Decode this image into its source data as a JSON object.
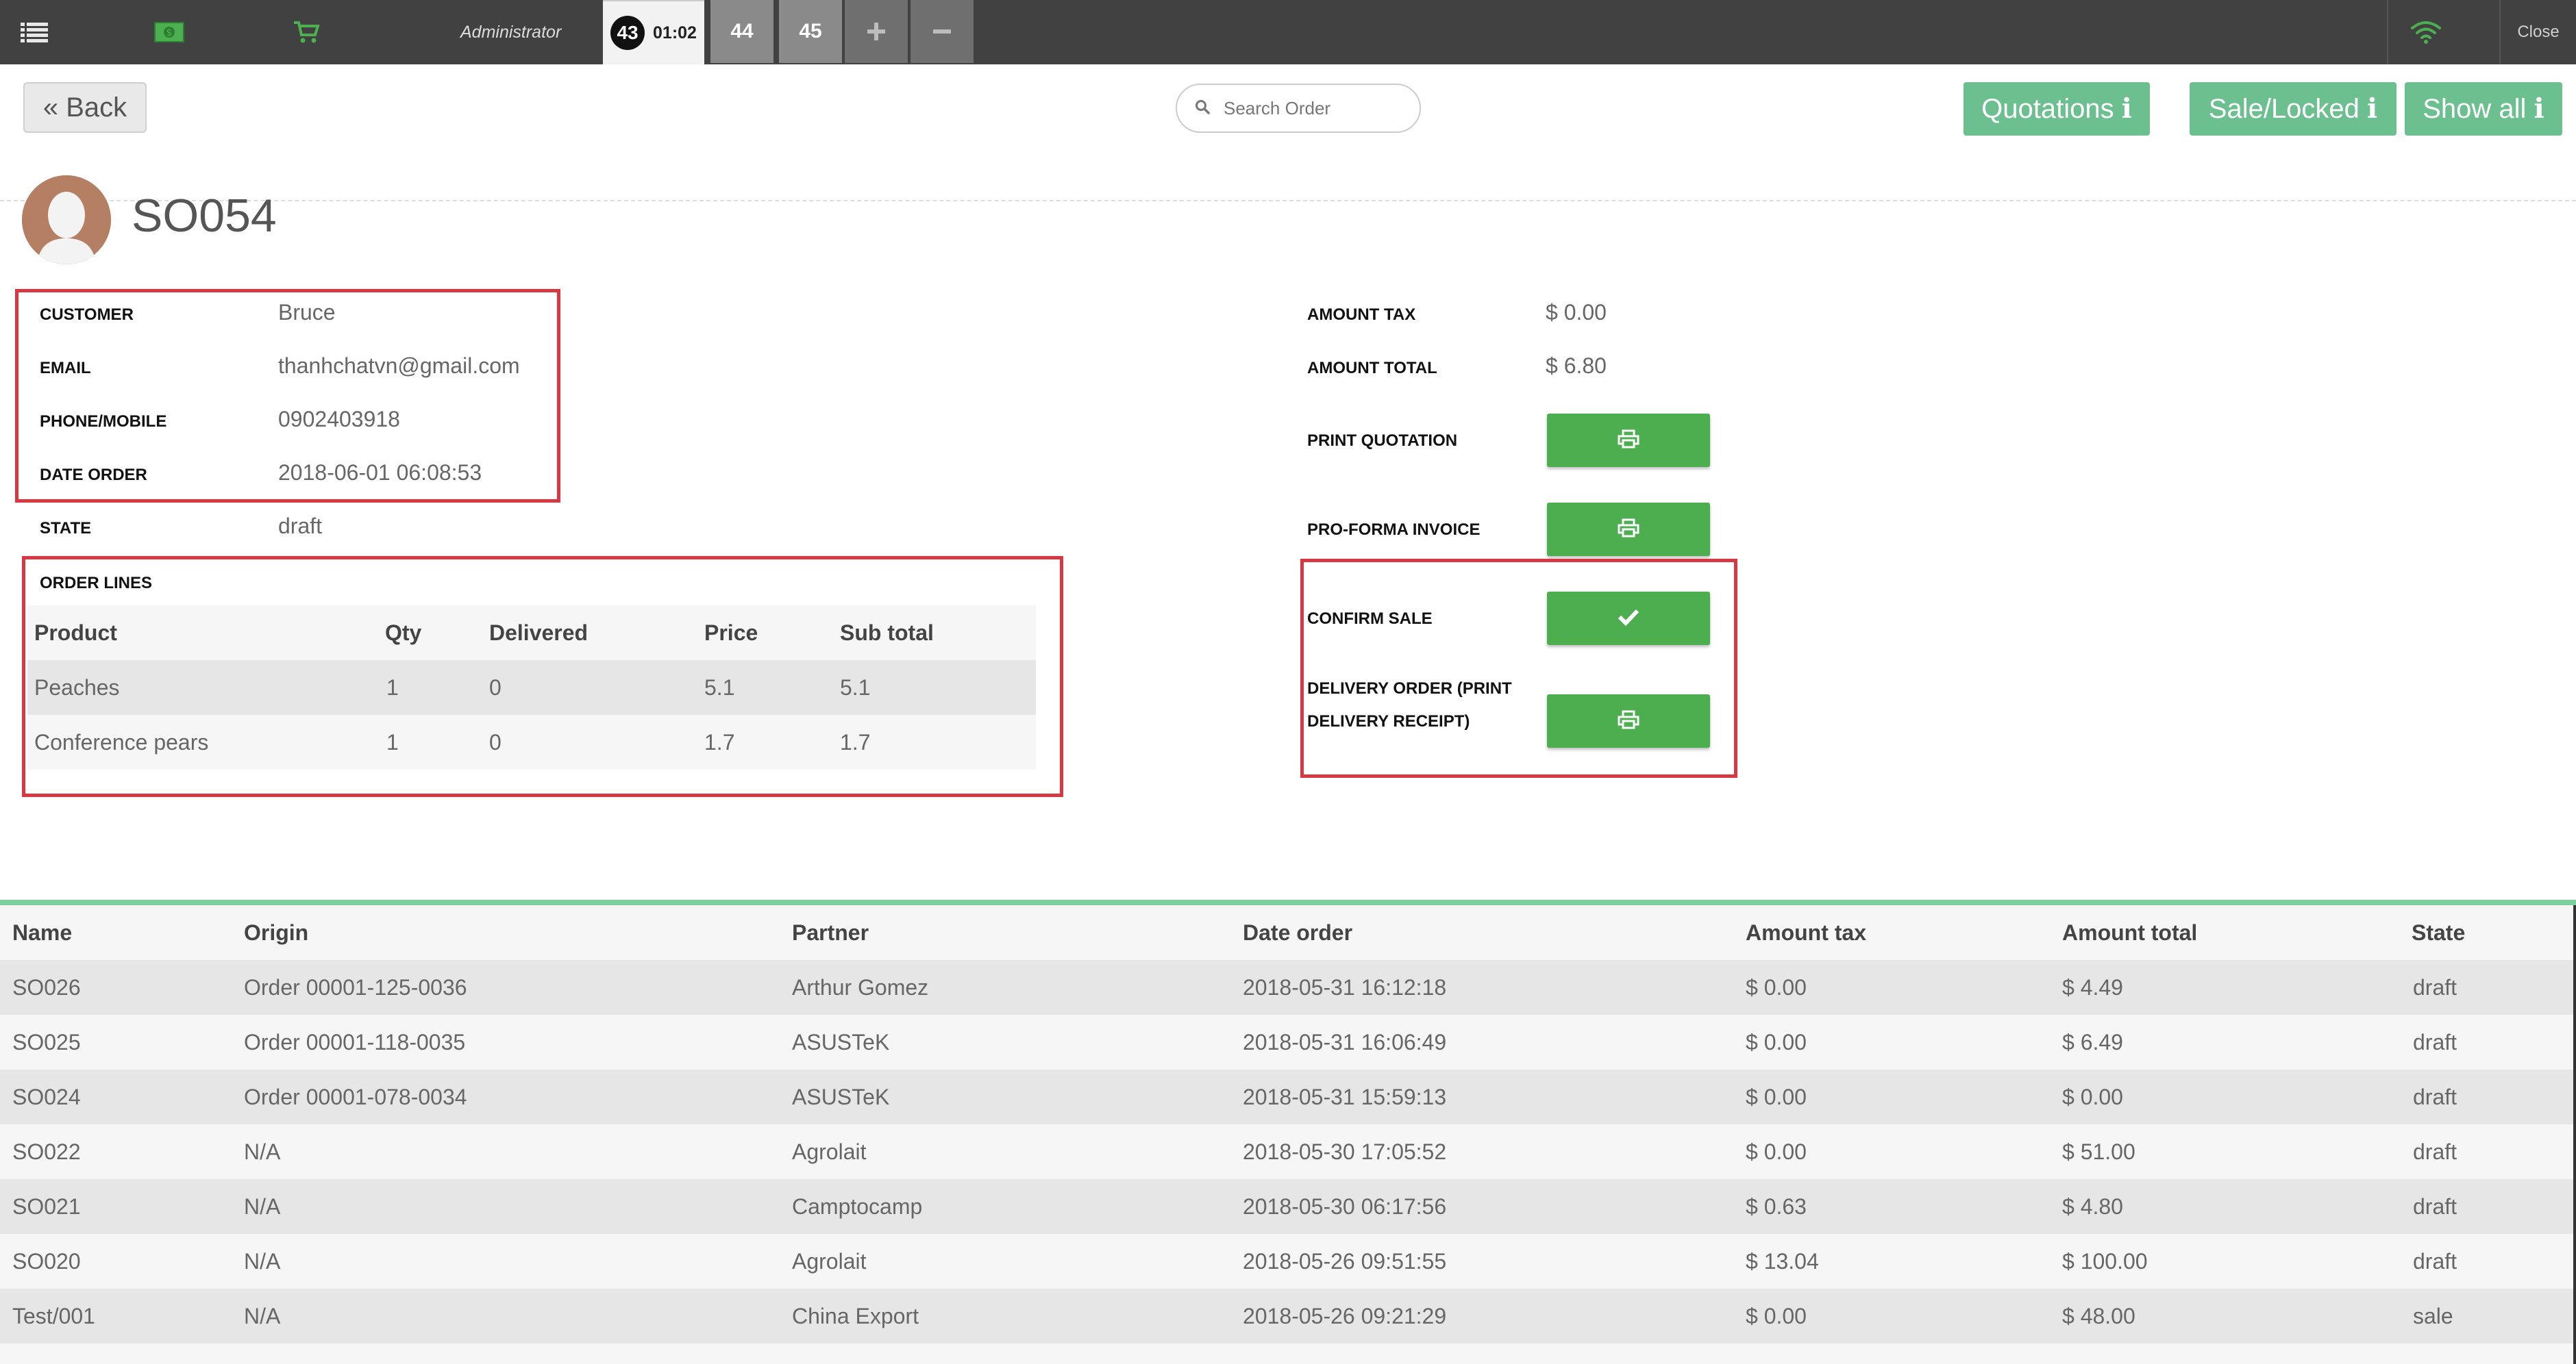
{
  "topbar": {
    "user": "Administrator",
    "orders": [
      {
        "number": "43",
        "time": "01:02",
        "active": true
      },
      {
        "number": "44",
        "active": false
      },
      {
        "number": "45",
        "active": false
      }
    ],
    "close_label": "Close"
  },
  "header": {
    "back_label": "« Back",
    "search_placeholder": "Search Order",
    "quotations_label": "Quotations ℹ",
    "sale_locked_label": "Sale/Locked ℹ",
    "show_all_label": "Show all ℹ"
  },
  "order": {
    "name": "SO054",
    "customer_label": "CUSTOMER",
    "customer": "Bruce",
    "email_label": "EMAIL",
    "email": "thanhchatvn@gmail.com",
    "phone_label": "PHONE/MOBILE",
    "phone": "0902403918",
    "date_label": "DATE ORDER",
    "date": "2018-06-01 06:08:53",
    "state_label": "STATE",
    "state": "draft",
    "amount_tax_label": "AMOUNT TAX",
    "amount_tax": "$ 0.00",
    "amount_total_label": "AMOUNT TOTAL",
    "amount_total": "$ 6.80",
    "print_quotation_label": "PRINT QUOTATION",
    "proforma_label": "PRO-FORMA INVOICE",
    "confirm_sale_label": "CONFIRM SALE",
    "delivery_label_1": "DELIVERY ORDER (PRINT",
    "delivery_label_2": "DELIVERY RECEIPT)"
  },
  "order_lines": {
    "title": "ORDER LINES",
    "headers": [
      "Product",
      "Qty",
      "Delivered",
      "Price",
      "Sub total"
    ],
    "rows": [
      [
        "Peaches",
        "1",
        "0",
        "5.1",
        "5.1"
      ],
      [
        "Conference pears",
        "1",
        "0",
        "1.7",
        "1.7"
      ]
    ]
  },
  "orders_table": {
    "headers": [
      "Name",
      "Origin",
      "Partner",
      "Date order",
      "Amount tax",
      "Amount total",
      "State"
    ],
    "rows": [
      [
        "SO026",
        "Order 00001-125-0036",
        "Arthur Gomez",
        "2018-05-31 16:12:18",
        "$ 0.00",
        "$ 4.49",
        "draft"
      ],
      [
        "SO025",
        "Order 00001-118-0035",
        "ASUSTeK",
        "2018-05-31 16:06:49",
        "$ 0.00",
        "$ 6.49",
        "draft"
      ],
      [
        "SO024",
        "Order 00001-078-0034",
        "ASUSTeK",
        "2018-05-31 15:59:13",
        "$ 0.00",
        "$ 0.00",
        "draft"
      ],
      [
        "SO022",
        "N/A",
        "Agrolait",
        "2018-05-30 17:05:52",
        "$ 0.00",
        "$ 51.00",
        "draft"
      ],
      [
        "SO021",
        "N/A",
        "Camptocamp",
        "2018-05-30 06:17:56",
        "$ 0.63",
        "$ 4.80",
        "draft"
      ],
      [
        "SO020",
        "N/A",
        "Agrolait",
        "2018-05-26 09:51:55",
        "$ 13.04",
        "$ 100.00",
        "draft"
      ],
      [
        "Test/001",
        "N/A",
        "China Export",
        "2018-05-26 09:21:29",
        "$ 0.00",
        "$ 48.00",
        "sale"
      ]
    ]
  },
  "icons": {
    "menu": "list-icon",
    "cash": "money-icon",
    "cart": "cart-icon",
    "wifi": "wifi-icon",
    "print": "print-icon",
    "check": "check-icon",
    "search": "search-icon"
  },
  "colors": {
    "topbar": "#414141",
    "accent_green": "#6cc08f",
    "button_green": "#4cae4f",
    "highlight_red": "#d93843"
  }
}
